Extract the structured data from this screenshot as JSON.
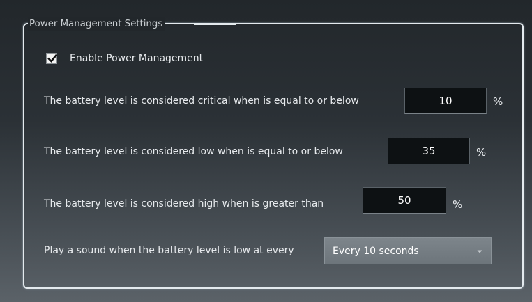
{
  "group": {
    "title": "Power Management Settings"
  },
  "enable": {
    "label": "Enable Power Management",
    "checked": true
  },
  "critical": {
    "label": "The battery level is considered critical when is equal to or below",
    "value": "10",
    "unit": "%"
  },
  "low": {
    "label": "The battery level is considered low when is equal to or below",
    "value": "35",
    "unit": "%"
  },
  "high": {
    "label": "The battery level is considered high when is greater than",
    "value": "50",
    "unit": "%"
  },
  "sound": {
    "label": "Play a sound when the battery level is low at every",
    "selected": "Every 10 seconds"
  },
  "icons": {
    "check": "check-icon",
    "dropdown": "chevron-down-icon"
  },
  "colors": {
    "background_top": "#22272b",
    "background_bottom": "#5b6268",
    "group_border": "#e4eaee",
    "input_background": "#0d1113",
    "text": "#e6e9ec"
  }
}
